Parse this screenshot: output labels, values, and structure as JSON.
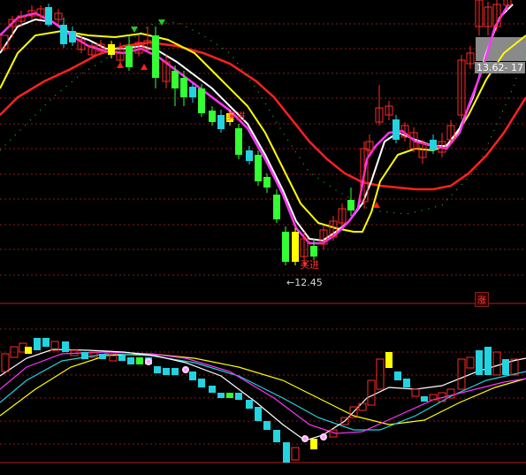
{
  "labels": {
    "buy_signal": "买进",
    "price_low": "←12.45",
    "price_tag": "13.62- 17",
    "rise_badge": "涨"
  },
  "colors": {
    "background": "#000000",
    "up_candle": "#ff2a2a",
    "down_candle_cyan": "#22d3e0",
    "down_candle_green": "#33ff33",
    "ma_white": "#ffffff",
    "ma_yellow": "#ffff00",
    "ma_magenta": "#ff33ff",
    "ma_red": "#ff2020",
    "dotted_line": "#22bb22",
    "grid": "#8a1a1a",
    "divider": "#b02020"
  },
  "chart_data": {
    "type": "candlestick",
    "panels": [
      "price",
      "indicator"
    ],
    "low_price_annotation": 12.45,
    "current_price_annotation": 13.62
  }
}
